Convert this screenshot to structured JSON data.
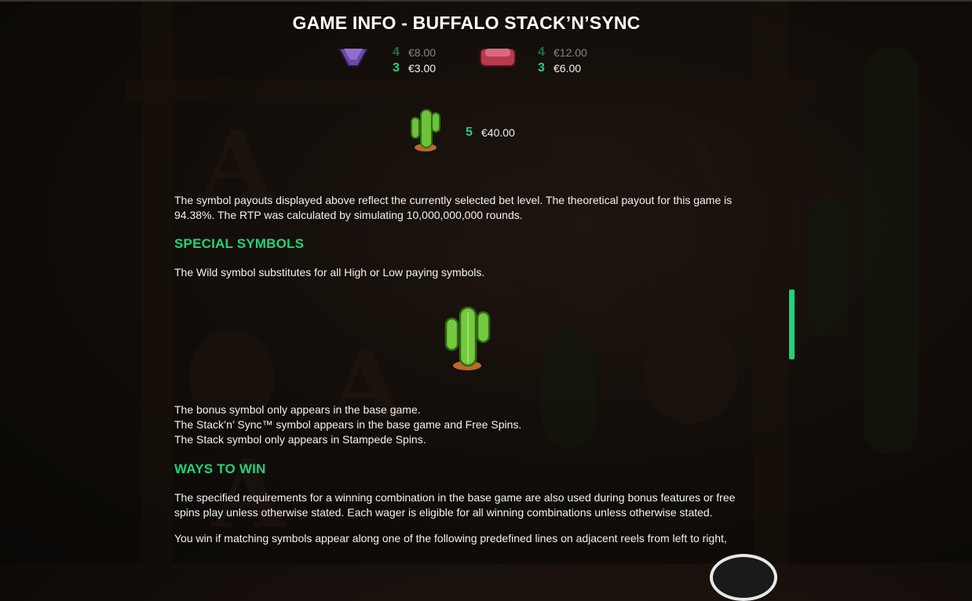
{
  "header": {
    "title": "GAME INFO - BUFFALO STACK’N’SYNC"
  },
  "paytable": {
    "left": {
      "cut_count": "4",
      "cut_amount": "€8.00",
      "count": "3",
      "amount": "€3.00",
      "icon": "purple-gem-icon"
    },
    "right": {
      "cut_count": "4",
      "cut_amount": "€12.00",
      "count": "3",
      "amount": "€6.00",
      "icon": "red-gem-icon"
    },
    "cactus": {
      "count": "5",
      "amount": "€40.00",
      "icon": "cactus-icon"
    }
  },
  "rtp_text_1": "The symbol payouts displayed above reflect the currently selected bet level. The theoretical payout for this game is",
  "rtp_text_2": "94.38%. The RTP was calculated by simulating 10,000,000,000 rounds.",
  "special": {
    "heading": "SPECIAL SYMBOLS",
    "wild_text": "The Wild symbol substitutes for all High or Low paying symbols.",
    "wild_icon": "cactus-wild-icon",
    "bonus_text": "The bonus symbol only appears in the base game.",
    "stack_sync_text": "The Stack’n’ Sync™ symbol appears in the base game and Free Spins.",
    "stack_text": "The Stack symbol only appears in Stampede Spins."
  },
  "ways": {
    "heading": "WAYS TO WIN",
    "text_1": "The specified requirements for a winning combination in the base game are also used during bonus features or free",
    "text_2": "spins play unless otherwise stated. Each wager is eligible for all winning combinations unless otherwise stated.",
    "text_3": "You win if matching symbols appear along one of the following predefined lines on adjacent reels from left to right,"
  },
  "colors": {
    "accent": "#1fd37a",
    "text": "#f2f2f2",
    "background": "#160f0b"
  }
}
